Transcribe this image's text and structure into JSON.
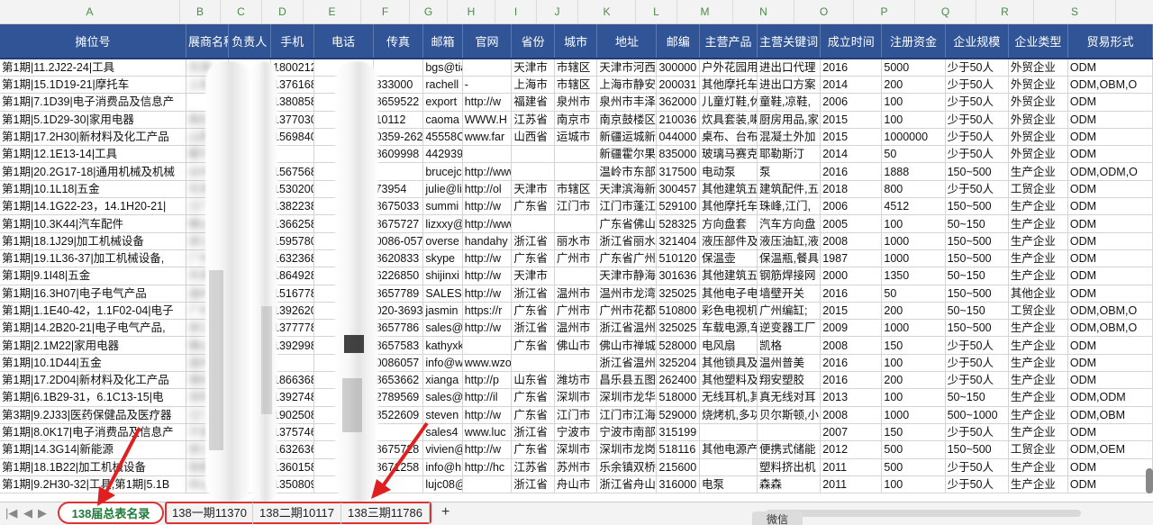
{
  "column_letters": [
    "A",
    "B",
    "C",
    "D",
    "E",
    "F",
    "G",
    "H",
    "I",
    "J",
    "K",
    "L",
    "M",
    "N",
    "O",
    "P",
    "Q",
    "R",
    "S"
  ],
  "headers": [
    "摊位号",
    "展商名称",
    "负责人",
    "手机",
    "电话",
    "传真",
    "邮箱",
    "官网",
    "省份",
    "城市",
    "地址",
    "邮编",
    "主营产品",
    "主营关键词",
    "成立时间",
    "注册资金",
    "企业规模",
    "企业类型",
    "贸易形式"
  ],
  "rows": [
    [
      "第1期|11.2J22-24|工具",
      "天津",
      "",
      "18002128",
      "",
      "",
      "bgs@tianjinlight",
      "",
      "天津市",
      "市辖区",
      "天津市河西",
      "300000",
      "户外花园用",
      "进出口代理",
      "2016",
      "5000",
      "少于50人",
      "外贸企业",
      "ODM"
    ],
    [
      "第1期|15.1D19-21|摩托车",
      "上海",
      "",
      "13761686",
      "",
      "333000",
      "rachell",
      "-",
      "上海市",
      "市辖区",
      "上海市静安",
      "200031",
      "其他摩托车",
      "进出口方案",
      "2014",
      "200",
      "少于50人",
      "外贸企业",
      "ODM,OBM,O"
    ],
    [
      "第1期|7.1D39|电子消费品及信息产",
      "",
      "",
      "13808586",
      "",
      "8659522",
      "export",
      "http://w",
      "福建省",
      "泉州市",
      "泉州市丰泽",
      "362000",
      "儿童灯鞋,休",
      "童鞋,凉鞋,",
      "2006",
      "100",
      "少于50人",
      "外贸企业",
      "ODM"
    ],
    [
      "第1期|5.1D29-30|家用电器",
      "南京",
      "",
      "13770302",
      "",
      "10112",
      "caoma",
      "WWW.H",
      "江苏省",
      "南京市",
      "南京鼓楼区",
      "210036",
      "炊具套装,喇",
      "厨房用品,家",
      "2015",
      "100",
      "少于50人",
      "外贸企业",
      "ODM"
    ],
    [
      "第1期|17.2H30|新材料及化工产品",
      "山西",
      "",
      "15698403",
      "",
      "0359-262",
      "45558C",
      "www.far",
      "山西省",
      "运城市",
      "新疆运城新",
      "044000",
      "桌布、台布",
      "混凝土外加",
      "2015",
      "1000000",
      "少于50人",
      "外贸企业",
      "ODM"
    ],
    [
      "第1期|12.1E13-14|工具",
      "霍尔",
      "",
      "",
      "",
      "8609998",
      "44293905@qq.com",
      "",
      "",
      "",
      "新疆霍尔果",
      "835000",
      "玻璃马赛克",
      "耶勒斯汀",
      "2014",
      "50",
      "少于50人",
      "外贸企业",
      "ODM"
    ],
    [
      "第1期|20.2G17-18|通用机械及机械",
      "台州",
      "",
      "15675685",
      "",
      "",
      "brucejc",
      "http://www.wolfsonpump",
      "",
      "",
      "温岭市东部",
      "317500",
      "电动泵",
      "泵",
      "2016",
      "1888",
      "150~500",
      "生产企业",
      "ODM,ODM,O"
    ],
    [
      "第1期|10.1L18|五金",
      "天津",
      "",
      "15302002",
      "",
      "73954",
      "julie@li",
      "http://ol",
      "天津市",
      "市辖区",
      "天津滨海新",
      "300457",
      "其他建筑五",
      "建筑配件,五",
      "2018",
      "800",
      "少于50人",
      "工贸企业",
      "ODM"
    ],
    [
      "第1期|14.1G22-23，14.1H20-21|",
      "江门",
      "",
      "13822386",
      "",
      "8675033",
      "summi",
      "http://w",
      "广东省",
      "江门市",
      "江门市蓬江",
      "529100",
      "其他摩托车",
      "珠峰,江门,",
      "2006",
      "4512",
      "150~500",
      "生产企业",
      "ODM"
    ],
    [
      "第1期|10.3K44|汽车配件",
      "佛山",
      "",
      "13662586",
      "",
      "8675727",
      "lizxxy@",
      "http://www.hombest.net",
      "",
      "",
      "广东省佛山",
      "528325",
      "方向盘套",
      "汽车方向盘",
      "2005",
      "100",
      "50~150",
      "生产企业",
      "ODM"
    ],
    [
      "第1期|18.1J29|加工机械设备",
      "浙江",
      "",
      "15957800",
      "",
      "0086-057",
      "overse",
      "handahy",
      "浙江省",
      "丽水市",
      "浙江省丽水",
      "321404",
      "液压部件及",
      "液压油缸,液",
      "2008",
      "1000",
      "150~500",
      "生产企业",
      "ODM"
    ],
    [
      "第1期|19.1L36-37|加工机械设备,",
      "广州",
      "",
      "16323686",
      "",
      "8620833",
      "skype",
      "http://w",
      "广东省",
      "广州市",
      "广东省广州",
      "510120",
      "保温壶",
      "保温瓶,餐具",
      "1987",
      "1000",
      "150~500",
      "生产企业",
      "ODM"
    ],
    [
      "第1期|9.1I48|五金",
      "天津",
      "",
      "18649286",
      "",
      "6226850",
      "shijinxi",
      "http://w",
      "天津市",
      "",
      "天津市静海",
      "301636",
      "其他建筑五",
      "钢筋焊接网",
      "2000",
      "1350",
      "50~150",
      "生产企业",
      "ODM"
    ],
    [
      "第1期|16.3H07|电子电气产品",
      "温州",
      "",
      "15167786",
      "",
      "8657789",
      "SALES",
      "http://w",
      "浙江省",
      "温州市",
      "温州市龙湾",
      "325025",
      "其他电子电",
      "墙壁开关",
      "2016",
      "50",
      "150~500",
      "其他企业",
      "ODM"
    ],
    [
      "第1期|1.1E40-42，1.1F02-04|电子",
      "广州",
      "",
      "13926202",
      "",
      "020-3693",
      "jasmin",
      "https://r",
      "广东省",
      "广州市",
      "广州市花都",
      "510800",
      "彩色电视机",
      "广州编缸;",
      "2015",
      "200",
      "50~150",
      "工贸企业",
      "ODM,OBM,O"
    ],
    [
      "第1期|14.2B20-21|电子电气产品,",
      "浙江",
      "",
      "13777786",
      "",
      "8657786",
      "sales@",
      "http://w",
      "浙江省",
      "温州市",
      "浙江省温州",
      "325025",
      "车载电源,车",
      "逆变器工厂",
      "2009",
      "1000",
      "150~500",
      "生产企业",
      "ODM,OBM,O"
    ],
    [
      "第1期|2.1M22|家用电器",
      "佛山",
      "",
      "13929986",
      "",
      "8657583",
      "kathyxks@163.c",
      "",
      "广东省",
      "佛山市",
      "佛山市禅城",
      "528000",
      "电风扇",
      "凯格",
      "2008",
      "150",
      "少于50人",
      "生产企业",
      "ODM"
    ],
    [
      "第1期|10.1D44|五金",
      "温州",
      "",
      "",
      "",
      "0086057",
      "info@w",
      "www.wzollie.com",
      "",
      "",
      "浙江省温州",
      "325204",
      "其他锁具及",
      "温州普美",
      "2016",
      "100",
      "少于50人",
      "生产企业",
      "ODM"
    ],
    [
      "第1期|17.2D04|新材料及化工产品",
      "潍坊",
      "",
      "18663686",
      "",
      "8653662",
      "xianga",
      "http://p",
      "山东省",
      "潍坊市",
      "昌乐县五图",
      "262400",
      "其他塑料及",
      "翔安塑胶",
      "2016",
      "200",
      "少于50人",
      "生产企业",
      "ODM"
    ],
    [
      "第1期|6.1B29-31，6.1C13-15|电",
      "深圳",
      "",
      "13927486",
      "",
      "2789569",
      "sales@",
      "http://il",
      "广东省",
      "深圳市",
      "深圳市龙华",
      "518000",
      "无线耳机,其",
      "真无线对耳",
      "2013",
      "100",
      "50~150",
      "生产企业",
      "ODM,ODM"
    ],
    [
      "第3期|9.2J33|医药保健品及医疗器",
      "江门",
      "",
      "19025086",
      "",
      "8522609",
      "steven",
      "http://w",
      "广东省",
      "江门市",
      "江门市江海",
      "529000",
      "烧烤机,多功",
      "贝尔斯顿,小",
      "2008",
      "1000",
      "500~1000",
      "生产企业",
      "ODM,OBM"
    ],
    [
      "第1期|8.0K17|电子消费品及信息产",
      "宁波",
      "",
      "13757468",
      "",
      "",
      "sales4",
      "www.luc",
      "浙江省",
      "宁波市",
      "宁波市南部",
      "315199",
      "",
      "",
      "2007",
      "150",
      "少于50人",
      "生产企业",
      "ODM"
    ],
    [
      "第1期|14.3G14|新能源",
      "浙江",
      "",
      "16326368",
      "",
      "8675728",
      "vivien@",
      "http://w",
      "广东省",
      "深圳市",
      "深圳市龙岗",
      "518116",
      "其他电源产",
      "便携式储能",
      "2012",
      "500",
      "150~500",
      "工贸企业",
      "ODM,OEM"
    ],
    [
      "第1期|18.1B22|加工机械设备",
      "张家",
      "",
      "13601586",
      "",
      "8671258",
      "info@h",
      "http://hc",
      "江苏省",
      "苏州市",
      "乐余镇双桥",
      "215600",
      "",
      "塑料挤出机",
      "2011",
      "500",
      "少于50人",
      "生产企业",
      "ODM"
    ],
    [
      "第1期|9.2H30-32|工具,第1期|5.1B",
      "舟山",
      "",
      "13508099",
      "",
      "",
      "lujc08@126.com",
      "",
      "浙江省",
      "舟山市",
      "浙江省舟山",
      "316000",
      "电泵",
      "森森",
      "2011",
      "100",
      "少于50人",
      "生产企业",
      "ODM"
    ]
  ],
  "sheet_tabs": [
    "138届总表名录",
    "138一期11370",
    "138二期10117",
    "138三期11786"
  ],
  "active_tab": "138届总表名录",
  "add_sheet_label": "+",
  "watermark_label": "微信",
  "nav_first": "|◀",
  "nav_prev": "◀",
  "nav_next": "▶",
  "nav_last": "▶|"
}
